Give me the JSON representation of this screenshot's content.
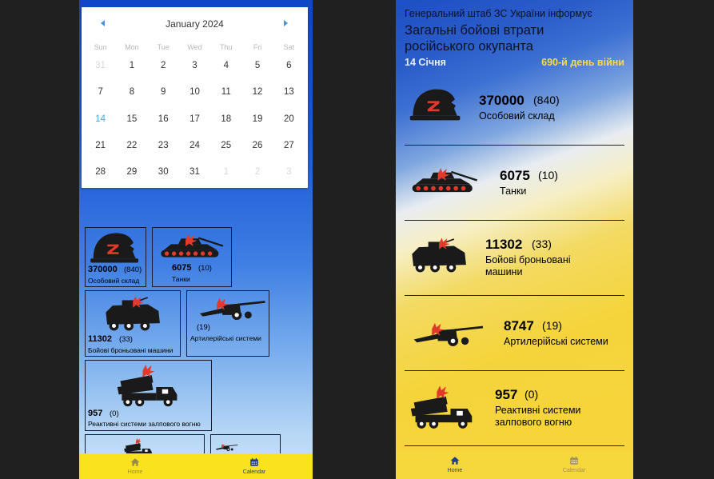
{
  "left": {
    "calendar": {
      "title": "January 2024",
      "dows": [
        "Sun",
        "Mon",
        "Tue",
        "Wed",
        "Thu",
        "Fri",
        "Sat"
      ],
      "weeks": [
        [
          "31",
          "1",
          "2",
          "3",
          "4",
          "5",
          "6"
        ],
        [
          "7",
          "8",
          "9",
          "10",
          "11",
          "12",
          "13"
        ],
        [
          "14",
          "15",
          "16",
          "17",
          "18",
          "19",
          "20"
        ],
        [
          "21",
          "22",
          "23",
          "24",
          "25",
          "26",
          "27"
        ],
        [
          "28",
          "29",
          "30",
          "31",
          "1",
          "2",
          "3"
        ]
      ]
    },
    "cards": [
      {
        "num": "370000",
        "delta": "(840)",
        "label": "Особовий склад"
      },
      {
        "num": "6075",
        "delta": "(10)",
        "label": "Танки"
      },
      {
        "num": "11302",
        "delta": "(33)",
        "label": "Бойові броньовані машини"
      },
      {
        "num": "",
        "delta": "(19)",
        "label": "Артилерійські системи"
      },
      {
        "num": "957",
        "delta": "(0)",
        "label": "Реактивні системи залпового вогню"
      }
    ],
    "tabs": {
      "home": "Home",
      "calendar": "Calendar"
    }
  },
  "right": {
    "header1": "Генеральний штаб ЗС України інформує",
    "header2": "Загальні бойові втрати російського окупанта",
    "date": "14 Січня",
    "war_day": "690-й день війни",
    "rows": [
      {
        "num": "370000",
        "delta": "(840)",
        "label": "Особовий склад"
      },
      {
        "num": "6075",
        "delta": "(10)",
        "label": "Танки"
      },
      {
        "num": "11302",
        "delta": "(33)",
        "label": "Бойові броньовані машини"
      },
      {
        "num": "8747",
        "delta": "(19)",
        "label": "Артилерійські системи"
      },
      {
        "num": "957",
        "delta": "(0)",
        "label": "Реактивні системи залпового вогню"
      }
    ],
    "tabs": {
      "home": "Home",
      "calendar": "Calendar"
    }
  },
  "icons": [
    "helmet-icon",
    "tank-icon",
    "armored-vehicle-icon",
    "artillery-icon",
    "rocket-launcher-icon",
    "home-icon",
    "calendar-icon",
    "chevron-left-icon",
    "chevron-right-icon"
  ],
  "colors": {
    "ua_blue": "#1046c8",
    "ua_yellow": "#fbe21e",
    "accent_blue": "#4aa6e0",
    "selected_tab": "#1f3f8a",
    "war_day": "#f9de3d"
  }
}
